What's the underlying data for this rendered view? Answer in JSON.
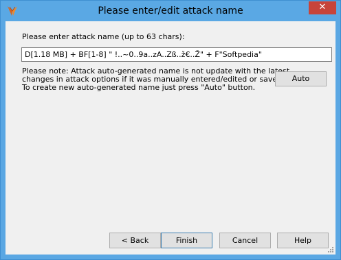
{
  "window": {
    "title": "Please enter/edit attack name",
    "close_symbol": "✕",
    "app_icon": "app-logo-icon",
    "accent_color": "#5aa8e4",
    "close_color": "#c7443a"
  },
  "form": {
    "prompt_label": "Please enter attack name (up to 63 chars):",
    "name_value": "D[1.18 MB] + BF[1-8] \" !..~0..9a..zA..Zß..ž€..Ž\" + F\"Softpedia\"",
    "note_lines": [
      "Please note: Attack auto-generated name is not update with the latest",
      "changes in attack options if it was manually entered/edited or saved ones.",
      "To create new auto-generated name just press \"Auto\" button."
    ],
    "auto_label": "Auto"
  },
  "buttons": {
    "back_label": "< Back",
    "finish_label": "Finish",
    "cancel_label": "Cancel",
    "help_label": "Help"
  }
}
